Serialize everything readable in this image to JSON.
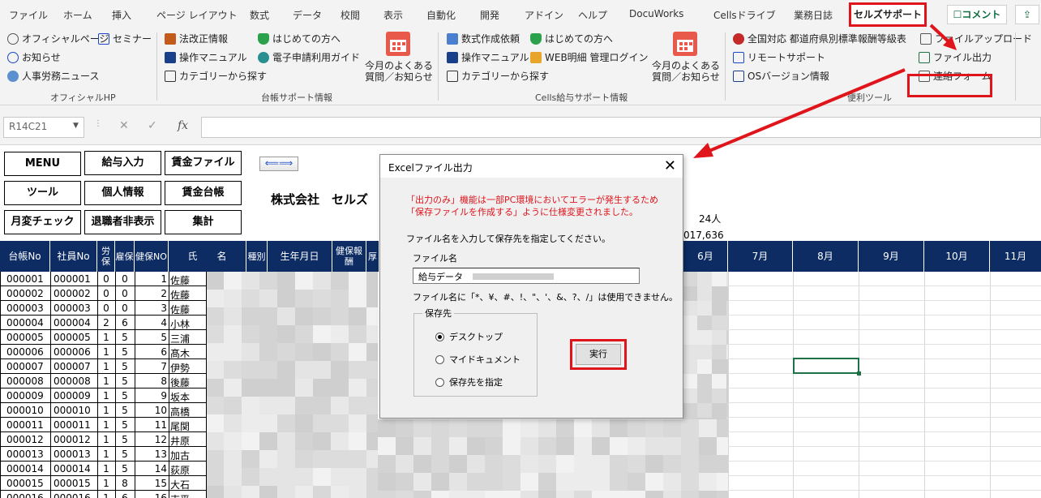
{
  "ribbon_tabs": [
    "ファイル",
    "ホーム",
    "挿入",
    "ページ レイアウト",
    "数式",
    "データ",
    "校閲",
    "表示",
    "自動化",
    "開発",
    "アドイン",
    "ヘルプ",
    "DocuWorks",
    "Cellsドライブ",
    "業務日誌",
    "セルズサポート"
  ],
  "comment_label": "コメント",
  "ribbon": {
    "hp": {
      "items": [
        "オフィシャルページ",
        "セミナー",
        "お知らせ",
        "人事労務ニュース"
      ],
      "label": "オフィシャルHP"
    },
    "ledger": {
      "items": [
        "法改正情報",
        "はじめての方へ",
        "操作マニュアル",
        "電子申請利用ガイド",
        "カテゴリーから探す"
      ],
      "faq": "今月のよくある\n質問／お知らせ",
      "label": "台帳サポート情報"
    },
    "payroll": {
      "items": [
        "数式作成依頼",
        "はじめての方へ",
        "操作マニュアル",
        "WEB明細 管理ログイン",
        "カテゴリーから探す"
      ],
      "faq": "今月のよくある\n質問／お知らせ",
      "label": "Cells給与サポート情報"
    },
    "tools": {
      "items": [
        "全国対応 都道府県別標準報酬等級表",
        "ファイルアップロード",
        "リモートサポート",
        "ファイル出力",
        "OSバージョン情報",
        "連絡フォーム"
      ],
      "label": "便利ツール"
    }
  },
  "namebox": "R14C21",
  "fx_label": "fx",
  "menu_buttons": [
    "MENU",
    "給与入力",
    "賃金ファイル",
    "ツール",
    "個人情報",
    "賃金台帳",
    "月変チェック",
    "退職者非表示",
    "集計"
  ],
  "arrow_button": "⟸⟹",
  "company": "株式会社　セルズ",
  "employee_count": "24人",
  "total_partial": "017,636",
  "headers": [
    "台帳No",
    "社員No",
    "労保",
    "雇保",
    "健保NO",
    "氏　　名",
    "種別",
    "生年月日",
    "健保報酬",
    "厚",
    "6月",
    "7月",
    "8月",
    "9月",
    "10月",
    "11月"
  ],
  "rows": [
    [
      "000001",
      "000001",
      "0",
      "0",
      "1",
      "佐藤"
    ],
    [
      "000002",
      "000002",
      "0",
      "0",
      "2",
      "佐藤"
    ],
    [
      "000003",
      "000003",
      "0",
      "0",
      "3",
      "佐藤"
    ],
    [
      "000004",
      "000004",
      "2",
      "6",
      "4",
      "小林"
    ],
    [
      "000005",
      "000005",
      "1",
      "5",
      "5",
      "三浦"
    ],
    [
      "000006",
      "000006",
      "1",
      "5",
      "6",
      "髙木"
    ],
    [
      "000007",
      "000007",
      "1",
      "5",
      "7",
      "伊勢"
    ],
    [
      "000008",
      "000008",
      "1",
      "5",
      "8",
      "後藤"
    ],
    [
      "000009",
      "000009",
      "1",
      "5",
      "9",
      "坂本"
    ],
    [
      "000010",
      "000010",
      "1",
      "5",
      "10",
      "高橋"
    ],
    [
      "000011",
      "000011",
      "1",
      "5",
      "11",
      "尾関"
    ],
    [
      "000012",
      "000012",
      "1",
      "5",
      "12",
      "井原"
    ],
    [
      "000013",
      "000013",
      "1",
      "5",
      "13",
      "加古"
    ],
    [
      "000014",
      "000014",
      "1",
      "5",
      "14",
      "荻原"
    ],
    [
      "000015",
      "000015",
      "1",
      "8",
      "15",
      "大石"
    ],
    [
      "000016",
      "000016",
      "1",
      "6",
      "16",
      "吉平"
    ]
  ],
  "dialog": {
    "title": "Excelファイル出力",
    "warning_line1": "「出力のみ」機能は一部PC環境においてエラーが発生するため",
    "warning_line2": "「保存ファイルを作成する」ように仕様変更されました。",
    "instruction": "ファイル名を入力して保存先を指定してください。",
    "filename_label": "ファイル名",
    "filename_value": "給与データ",
    "invalid_chars_note": "ファイル名に「*、¥、#、!、\"、'、&、?、/」は使用できません。",
    "save_group_label": "保存先",
    "options": [
      "デスクトップ",
      "マイドキュメント",
      "保存先を指定"
    ],
    "selected_option": "デスクトップ",
    "execute_label": "実行",
    "close_icon": "close-icon"
  },
  "colors": {
    "header_bg": "#0c2c63",
    "highlight": "#e0141b",
    "warning_text": "#e0141b"
  }
}
